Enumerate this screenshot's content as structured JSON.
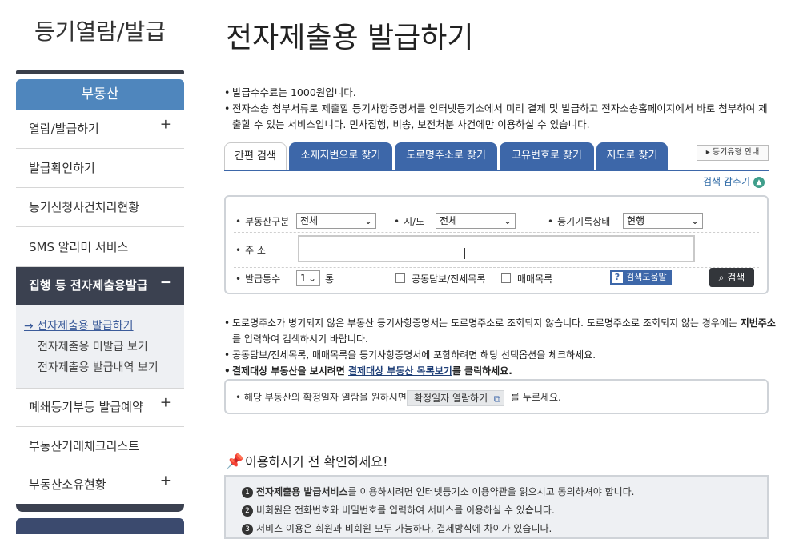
{
  "sidebar": {
    "title": "등기열람/발급",
    "category": "부동산",
    "items": [
      {
        "label": "열람/발급하기",
        "plus": "+"
      },
      {
        "label": "발급확인하기"
      },
      {
        "label": "등기신청사건처리현황"
      },
      {
        "label": "SMS 알리미 서비스"
      },
      {
        "label": "집행 등 전자제출용발급",
        "plus": "−"
      },
      {
        "label": "폐쇄등기부등 발급예약",
        "plus": "+"
      },
      {
        "label": "부동산거래체크리스트"
      },
      {
        "label": "부동산소유현황",
        "plus": "+"
      }
    ],
    "subitems": [
      "→ 전자제출용 발급하기",
      "전자제출용 미발급 보기",
      "전자제출용 발급내역 보기"
    ]
  },
  "main": {
    "title": "전자제출용 발급하기",
    "notes_top": [
      "발급수수료는 1000원입니다.",
      "전자소송 첨부서류로 제출할 등기사항증명서를 인터넷등기소에서 미리 결제 및 발급하고 전자소송홈페이지에서 바로 첨부하여 제출할 수 있는 서비스입니다. 민사집행, 비송, 보전처분 사건에만 이용하실 수 있습니다."
    ],
    "tabs": [
      "간편 검색",
      "소재지번으로 찾기",
      "도로명주소로 찾기",
      "고유번호로 찾기",
      "지도로 찾기"
    ],
    "guide_button": "▸ 등기유형 안내",
    "hide_search": "검색 감추기",
    "hide_icon": "chevron-up-icon",
    "form": {
      "type_label": "부동산구분",
      "type_value": "전체",
      "region_label": "시/도",
      "region_value": "전체",
      "status_label": "등기기록상태",
      "status_value": "현행",
      "address_label": "주 소",
      "address_value": "",
      "count_label": "발급통수",
      "count_value": "1",
      "count_unit": "통",
      "check1": "공동담보/전세목록",
      "check2": "매매목록",
      "help_label": "검색도움말",
      "search_label": "검색"
    },
    "notes_mid": [
      "도로명주소가 병기되지 않은 부동산 등기사항증명서는 도로명주소로 조회되지 않습니다. 도로명주소로 조회되지 않는 경우에는 ",
      "지번주소",
      "를 입력하여 검색하시기 바랍니다.",
      "공동담보/전세목록, 매매목록을 등기사항증명서에 포함하려면 해당 선택옵션을 체크하세요.",
      "결제대상 부동산을 보시려면 ",
      "결제대상 부동산 목록보기",
      "를 클릭하세요."
    ],
    "info": {
      "text": "해당 부동산의 확정일자 열람을 원하시면",
      "button": "확정일자 열람하기",
      "tail": "를 누르세요."
    },
    "confirm": {
      "title": "이용하시기 전 확인하세요!",
      "items": [
        {
          "num": "1",
          "bold": "전자제출용 발급서비스",
          "text": "를 이용하시려면 인터넷등기소 이용약관을 읽으시고 동의하셔야 합니다."
        },
        {
          "num": "2",
          "bold": "",
          "text": "비회원은 전화번호와 비밀번호를 입력하여 서비스를 이용하실 수 있습니다."
        },
        {
          "num": "3",
          "bold": "",
          "text": "서비스 이용은 회원과 비회원 모두 가능하나, 결제방식에 차이가 있습니다."
        }
      ]
    }
  }
}
